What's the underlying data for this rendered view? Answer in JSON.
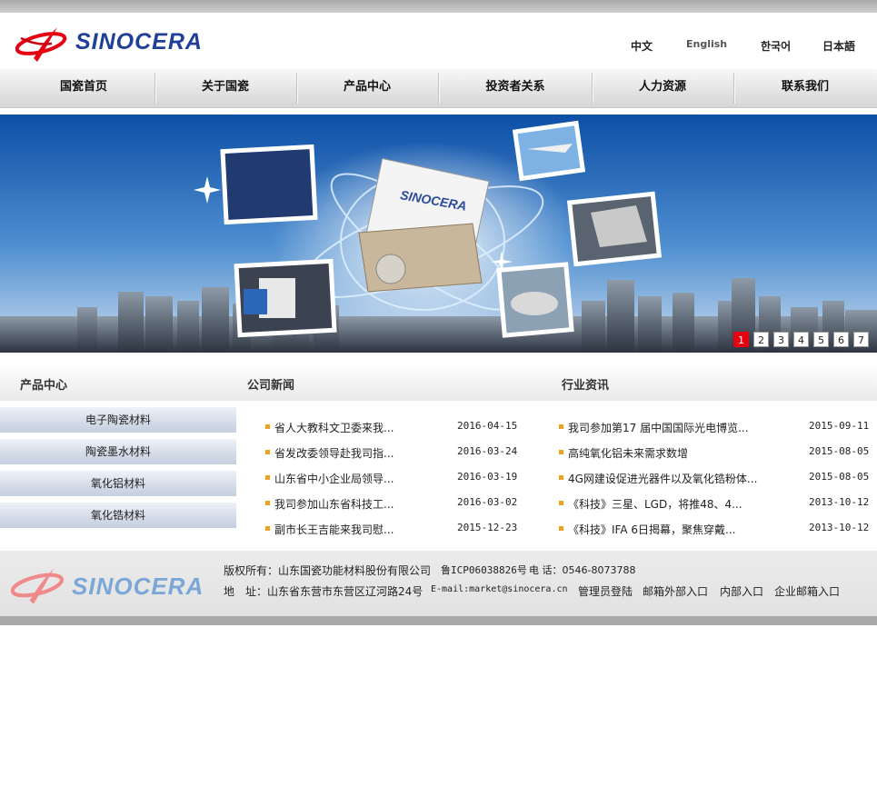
{
  "brand": {
    "name": "SINOCERA"
  },
  "languages": [
    "中文",
    "English",
    "한국어",
    "日本語"
  ],
  "nav": [
    "国瓷首页",
    "关于国瓷",
    "产品中心",
    "投资者关系",
    "人力资源",
    "联系我们"
  ],
  "banner": {
    "logo_text": "SINOCERA",
    "pages": [
      "1",
      "2",
      "3",
      "4",
      "5",
      "6",
      "7"
    ],
    "active_page": "1"
  },
  "sections": {
    "products_title": "产品中心",
    "company_news_title": "公司新闻",
    "industry_news_title": "行业资讯"
  },
  "product_categories": [
    "电子陶瓷材料",
    "陶瓷墨水材料",
    "氧化铝材料",
    "氧化锆材料"
  ],
  "company_news": [
    {
      "title": "省人大教科文卫委来我...",
      "date": "2016-04-15"
    },
    {
      "title": "省发改委领导赴我司指...",
      "date": "2016-03-24"
    },
    {
      "title": "山东省中小企业局领导...",
      "date": "2016-03-19"
    },
    {
      "title": "我司参加山东省科技工...",
      "date": "2016-03-02"
    },
    {
      "title": "副市长王吉能来我司慰...",
      "date": "2015-12-23"
    }
  ],
  "industry_news": [
    {
      "title": "我司参加第17 届中国国际光电博览...",
      "date": "2015-09-11"
    },
    {
      "title": "高纯氧化铝未来需求数增",
      "date": "2015-08-05"
    },
    {
      "title": "4G网建设促进光器件以及氧化锆粉体...",
      "date": "2015-08-05"
    },
    {
      "title": "《科技》三星、LGD，将推48、4...",
      "date": "2013-10-12"
    },
    {
      "title": "《科技》IFA 6日揭幕，聚焦穿戴...",
      "date": "2013-10-12"
    }
  ],
  "footer": {
    "logo_text": "SINOCERA",
    "copyright": "版权所有：山东国瓷功能材料股份有限公司",
    "icp": "鲁ICP06038826号",
    "phone": "电 话：0546-8073788",
    "address": "地　址：山东省东营市东营区辽河路24号",
    "email": "E-mail:market@sinocera.cn",
    "links": [
      "管理员登陆",
      "邮箱外部入口",
      "内部入口",
      "企业邮箱入口"
    ]
  },
  "colors": {
    "brand_blue": "#1f3f98",
    "brand_red": "#e60012",
    "footer_logo_blue": "#7aa7d8",
    "bullet_orange": "#f0a020"
  }
}
